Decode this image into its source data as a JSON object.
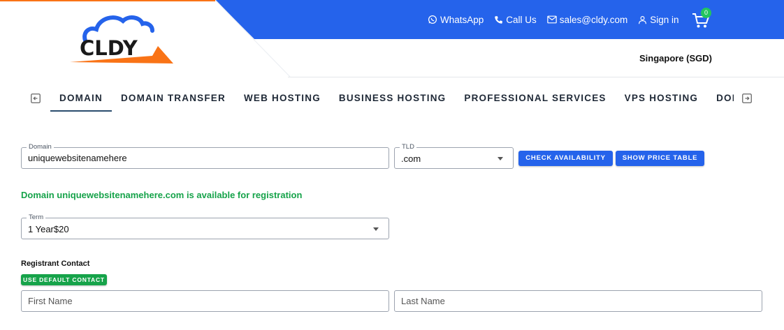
{
  "brand": {
    "logo_text": "CLDY",
    "colors": {
      "primary": "#2563eb",
      "accent_orange": "#f97316",
      "success": "#16a34a"
    }
  },
  "header": {
    "links": [
      {
        "label": "WhatsApp",
        "icon": "whatsapp-icon"
      },
      {
        "label": "Call Us",
        "icon": "phone-icon"
      },
      {
        "label": "sales@cldy.com",
        "icon": "mail-icon"
      },
      {
        "label": "Sign in",
        "icon": "user-icon"
      }
    ],
    "cart_count": "0",
    "currency": "Singapore (SGD)"
  },
  "nav": {
    "tabs": [
      "DOMAIN",
      "DOMAIN TRANSFER",
      "WEB HOSTING",
      "BUSINESS HOSTING",
      "PROFESSIONAL SERVICES",
      "VPS HOSTING",
      "DOMAIN SERVICES"
    ],
    "active": "DOMAIN"
  },
  "search": {
    "domain_label": "Domain",
    "domain_value": "uniquewebsitenamehere",
    "tld_label": "TLD",
    "tld_value": ".com",
    "check_button": "CHECK AVAILABILITY",
    "price_button": "SHOW PRICE TABLE"
  },
  "result": {
    "message": "Domain uniquewebsitenamehere.com is available for registration"
  },
  "term": {
    "label": "Term",
    "value": "1 Year$20"
  },
  "contact": {
    "title": "Registrant Contact",
    "default_button": "USE DEFAULT CONTACT",
    "first_name_placeholder": "First Name",
    "last_name_placeholder": "Last Name"
  }
}
